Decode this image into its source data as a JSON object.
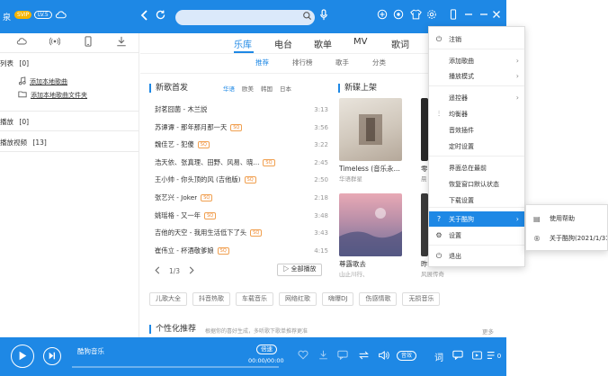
{
  "topbar": {
    "brand": "泉",
    "vip": "SVIP",
    "level": "LV.5",
    "search_value": "",
    "icons": [
      "cloud-icon",
      "back-icon",
      "refresh-icon",
      "mic-icon",
      "add-icon",
      "game-icon",
      "skin-icon",
      "settings-icon",
      "mini-mode-icon",
      "minimize-icon",
      "close-icon"
    ]
  },
  "sidebar": {
    "icons": [
      "cloud-icon",
      "radio-icon",
      "device-icon",
      "download-icon"
    ],
    "playlist_label": "列表",
    "playlist_count": "[0]",
    "add_local_song": "添加本地歌曲",
    "add_local_folder": "添加本地歌曲文件夹",
    "recent_label": "播放",
    "recent_count": "[0]",
    "video_label": "播放视频",
    "video_count": "[13]"
  },
  "main": {
    "tabs": [
      "乐库",
      "电台",
      "歌单",
      "MV",
      "歌词"
    ],
    "active_tab": 0,
    "subtabs": [
      "推荐",
      "排行榜",
      "歌手",
      "分类"
    ],
    "active_subtab": 0,
    "new_songs_title": "新歌首发",
    "filters": [
      "华语",
      "欧美",
      "韩国",
      "日本"
    ],
    "active_filter": 0,
    "songs": [
      {
        "name": "封茗囧菌 - 木兰説",
        "quality": "",
        "duration": "3:13"
      },
      {
        "name": "苏谭谭 - 那年那月那一天",
        "quality": "SQ",
        "duration": "3:56"
      },
      {
        "name": "魏佳艺 - 犯傻",
        "quality": "SQ",
        "duration": "3:22"
      },
      {
        "name": "浩天依、张真理、田野、风易、晓...",
        "quality": "SQ",
        "duration": "2:45"
      },
      {
        "name": "王小帅 - 你头顶的风 (吉他版)",
        "quality": "SQ",
        "duration": "2:50"
      },
      {
        "name": "张艺兴 - Joker",
        "quality": "SQ",
        "duration": "2:18"
      },
      {
        "name": "姚瑶格 - 又一年",
        "quality": "SQ",
        "duration": "3:48"
      },
      {
        "name": "吉他的天空 - 我用生活低下了头",
        "quality": "SQ",
        "duration": "3:43"
      },
      {
        "name": "崔伟立 - 杯酒敬爹娘",
        "quality": "SQ",
        "duration": "4:15"
      }
    ],
    "pager": "1/3",
    "play_all": "全部播放",
    "new_albums_title": "新碟上架",
    "albums": [
      {
        "title": "Timeless (音乐永...",
        "artist": "华语群星"
      },
      {
        "title": "零",
        "artist": "晨"
      },
      {
        "title": "尊露歌去",
        "artist": "山止川行、"
      },
      {
        "title": "昨",
        "artist": "风展传奇"
      }
    ],
    "chips": [
      "儿歌大全",
      "抖音热歌",
      "车载音乐",
      "网络红歌",
      "嗨爆DJ",
      "伤感情歌",
      "无损音乐"
    ],
    "rec_title": "个性化推荐",
    "rec_desc": "根据你的喜好生成，多听歌下歌单推荐更准",
    "more": "更多"
  },
  "player": {
    "song_title": "酷狗音乐",
    "speed": "倍速",
    "time": "00:00/00:00",
    "quality": "音效",
    "lyric": "词",
    "playlist_count": "0"
  },
  "menu": {
    "items": [
      {
        "label": "注销",
        "icon": "logout-icon",
        "glyph": "⏻",
        "arrow": false
      },
      {
        "label": "添加歌曲",
        "icon": "",
        "glyph": "",
        "arrow": true
      },
      {
        "label": "播放模式",
        "icon": "",
        "glyph": "",
        "arrow": true
      },
      {
        "label": "遥控器",
        "icon": "",
        "glyph": "",
        "arrow": true
      },
      {
        "label": "均衡器",
        "icon": "equalizer-icon",
        "glyph": "⫶",
        "arrow": false
      },
      {
        "label": "音效插件",
        "icon": "",
        "glyph": "",
        "arrow": false
      },
      {
        "label": "定时设置",
        "icon": "",
        "glyph": "",
        "arrow": false
      },
      {
        "label": "界面总在最前",
        "icon": "",
        "glyph": "",
        "arrow": false
      },
      {
        "label": "恢复窗口默认状态",
        "icon": "",
        "glyph": "",
        "arrow": false
      },
      {
        "label": "下载设置",
        "icon": "",
        "glyph": "",
        "arrow": false
      },
      {
        "label": "关于酷狗",
        "icon": "help-icon",
        "glyph": "?",
        "arrow": true
      },
      {
        "label": "设置",
        "icon": "gear-icon",
        "glyph": "⚙",
        "arrow": false
      },
      {
        "label": "退出",
        "icon": "power-icon",
        "glyph": "⏻",
        "arrow": false
      }
    ],
    "active_index": 10
  },
  "submenu": {
    "items": [
      {
        "label": "使用帮助",
        "icon": "help-doc-icon"
      },
      {
        "label": "关于酷狗(2021/1/31)",
        "icon": "kugou-icon"
      }
    ]
  },
  "colors": {
    "accent": "#1e88e5",
    "quality": "#f08a30"
  }
}
